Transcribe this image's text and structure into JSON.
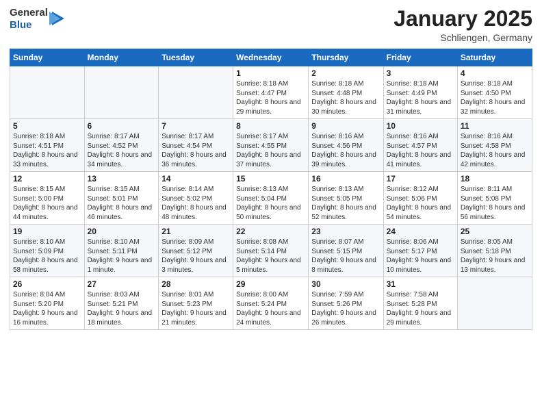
{
  "logo": {
    "general": "General",
    "blue": "Blue"
  },
  "title": {
    "month": "January 2025",
    "location": "Schliengen, Germany"
  },
  "calendar": {
    "headers": [
      "Sunday",
      "Monday",
      "Tuesday",
      "Wednesday",
      "Thursday",
      "Friday",
      "Saturday"
    ],
    "rows": [
      [
        {
          "day": "",
          "sunrise": "",
          "sunset": "",
          "daylight": ""
        },
        {
          "day": "",
          "sunrise": "",
          "sunset": "",
          "daylight": ""
        },
        {
          "day": "",
          "sunrise": "",
          "sunset": "",
          "daylight": ""
        },
        {
          "day": "1",
          "sunrise": "Sunrise: 8:18 AM",
          "sunset": "Sunset: 4:47 PM",
          "daylight": "Daylight: 8 hours and 29 minutes."
        },
        {
          "day": "2",
          "sunrise": "Sunrise: 8:18 AM",
          "sunset": "Sunset: 4:48 PM",
          "daylight": "Daylight: 8 hours and 30 minutes."
        },
        {
          "day": "3",
          "sunrise": "Sunrise: 8:18 AM",
          "sunset": "Sunset: 4:49 PM",
          "daylight": "Daylight: 8 hours and 31 minutes."
        },
        {
          "day": "4",
          "sunrise": "Sunrise: 8:18 AM",
          "sunset": "Sunset: 4:50 PM",
          "daylight": "Daylight: 8 hours and 32 minutes."
        }
      ],
      [
        {
          "day": "5",
          "sunrise": "Sunrise: 8:18 AM",
          "sunset": "Sunset: 4:51 PM",
          "daylight": "Daylight: 8 hours and 33 minutes."
        },
        {
          "day": "6",
          "sunrise": "Sunrise: 8:17 AM",
          "sunset": "Sunset: 4:52 PM",
          "daylight": "Daylight: 8 hours and 34 minutes."
        },
        {
          "day": "7",
          "sunrise": "Sunrise: 8:17 AM",
          "sunset": "Sunset: 4:54 PM",
          "daylight": "Daylight: 8 hours and 36 minutes."
        },
        {
          "day": "8",
          "sunrise": "Sunrise: 8:17 AM",
          "sunset": "Sunset: 4:55 PM",
          "daylight": "Daylight: 8 hours and 37 minutes."
        },
        {
          "day": "9",
          "sunrise": "Sunrise: 8:16 AM",
          "sunset": "Sunset: 4:56 PM",
          "daylight": "Daylight: 8 hours and 39 minutes."
        },
        {
          "day": "10",
          "sunrise": "Sunrise: 8:16 AM",
          "sunset": "Sunset: 4:57 PM",
          "daylight": "Daylight: 8 hours and 41 minutes."
        },
        {
          "day": "11",
          "sunrise": "Sunrise: 8:16 AM",
          "sunset": "Sunset: 4:58 PM",
          "daylight": "Daylight: 8 hours and 42 minutes."
        }
      ],
      [
        {
          "day": "12",
          "sunrise": "Sunrise: 8:15 AM",
          "sunset": "Sunset: 5:00 PM",
          "daylight": "Daylight: 8 hours and 44 minutes."
        },
        {
          "day": "13",
          "sunrise": "Sunrise: 8:15 AM",
          "sunset": "Sunset: 5:01 PM",
          "daylight": "Daylight: 8 hours and 46 minutes."
        },
        {
          "day": "14",
          "sunrise": "Sunrise: 8:14 AM",
          "sunset": "Sunset: 5:02 PM",
          "daylight": "Daylight: 8 hours and 48 minutes."
        },
        {
          "day": "15",
          "sunrise": "Sunrise: 8:13 AM",
          "sunset": "Sunset: 5:04 PM",
          "daylight": "Daylight: 8 hours and 50 minutes."
        },
        {
          "day": "16",
          "sunrise": "Sunrise: 8:13 AM",
          "sunset": "Sunset: 5:05 PM",
          "daylight": "Daylight: 8 hours and 52 minutes."
        },
        {
          "day": "17",
          "sunrise": "Sunrise: 8:12 AM",
          "sunset": "Sunset: 5:06 PM",
          "daylight": "Daylight: 8 hours and 54 minutes."
        },
        {
          "day": "18",
          "sunrise": "Sunrise: 8:11 AM",
          "sunset": "Sunset: 5:08 PM",
          "daylight": "Daylight: 8 hours and 56 minutes."
        }
      ],
      [
        {
          "day": "19",
          "sunrise": "Sunrise: 8:10 AM",
          "sunset": "Sunset: 5:09 PM",
          "daylight": "Daylight: 8 hours and 58 minutes."
        },
        {
          "day": "20",
          "sunrise": "Sunrise: 8:10 AM",
          "sunset": "Sunset: 5:11 PM",
          "daylight": "Daylight: 9 hours and 1 minute."
        },
        {
          "day": "21",
          "sunrise": "Sunrise: 8:09 AM",
          "sunset": "Sunset: 5:12 PM",
          "daylight": "Daylight: 9 hours and 3 minutes."
        },
        {
          "day": "22",
          "sunrise": "Sunrise: 8:08 AM",
          "sunset": "Sunset: 5:14 PM",
          "daylight": "Daylight: 9 hours and 5 minutes."
        },
        {
          "day": "23",
          "sunrise": "Sunrise: 8:07 AM",
          "sunset": "Sunset: 5:15 PM",
          "daylight": "Daylight: 9 hours and 8 minutes."
        },
        {
          "day": "24",
          "sunrise": "Sunrise: 8:06 AM",
          "sunset": "Sunset: 5:17 PM",
          "daylight": "Daylight: 9 hours and 10 minutes."
        },
        {
          "day": "25",
          "sunrise": "Sunrise: 8:05 AM",
          "sunset": "Sunset: 5:18 PM",
          "daylight": "Daylight: 9 hours and 13 minutes."
        }
      ],
      [
        {
          "day": "26",
          "sunrise": "Sunrise: 8:04 AM",
          "sunset": "Sunset: 5:20 PM",
          "daylight": "Daylight: 9 hours and 16 minutes."
        },
        {
          "day": "27",
          "sunrise": "Sunrise: 8:03 AM",
          "sunset": "Sunset: 5:21 PM",
          "daylight": "Daylight: 9 hours and 18 minutes."
        },
        {
          "day": "28",
          "sunrise": "Sunrise: 8:01 AM",
          "sunset": "Sunset: 5:23 PM",
          "daylight": "Daylight: 9 hours and 21 minutes."
        },
        {
          "day": "29",
          "sunrise": "Sunrise: 8:00 AM",
          "sunset": "Sunset: 5:24 PM",
          "daylight": "Daylight: 9 hours and 24 minutes."
        },
        {
          "day": "30",
          "sunrise": "Sunrise: 7:59 AM",
          "sunset": "Sunset: 5:26 PM",
          "daylight": "Daylight: 9 hours and 26 minutes."
        },
        {
          "day": "31",
          "sunrise": "Sunrise: 7:58 AM",
          "sunset": "Sunset: 5:28 PM",
          "daylight": "Daylight: 9 hours and 29 minutes."
        },
        {
          "day": "",
          "sunrise": "",
          "sunset": "",
          "daylight": ""
        }
      ]
    ]
  }
}
